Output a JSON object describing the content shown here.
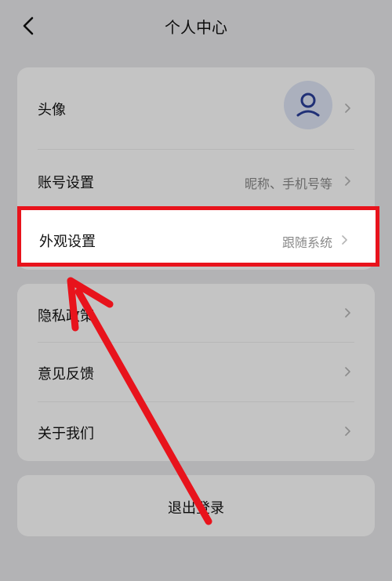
{
  "header": {
    "title": "个人中心"
  },
  "group1": {
    "avatar_label": "头像",
    "account_label": "账号设置",
    "account_value": "昵称、手机号等"
  },
  "highlight": {
    "label": "外观设置",
    "value": "跟随系统"
  },
  "group2": {
    "privacy_label": "隐私政策",
    "feedback_label": "意见反馈",
    "about_label": "关于我们"
  },
  "logout": {
    "label": "退出登录"
  },
  "colors": {
    "highlight_border": "#e8131c",
    "avatar_icon": "#2a3f9a",
    "avatar_bg": "#dfe6f6"
  }
}
